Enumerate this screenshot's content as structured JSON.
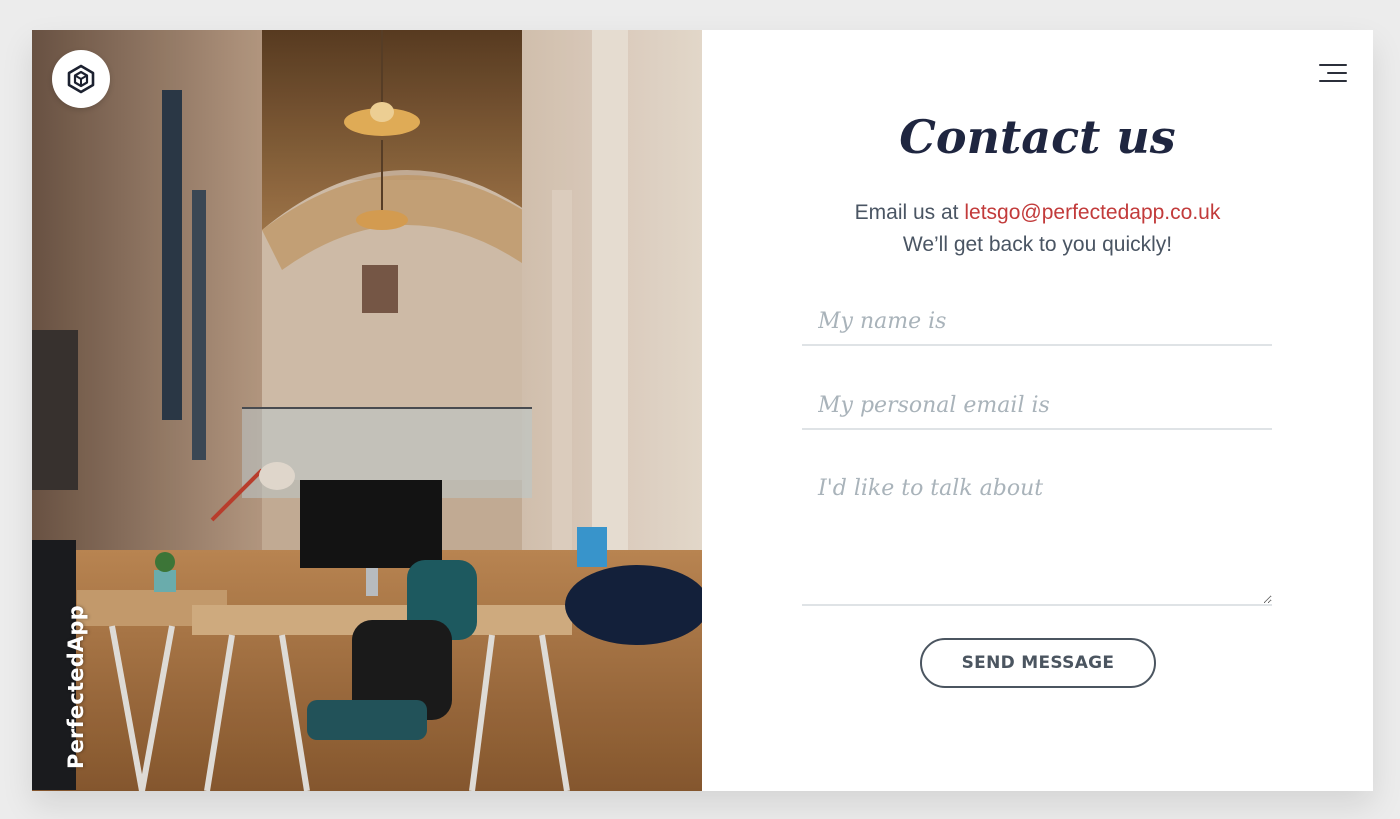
{
  "brand": {
    "name": "PerfectedApp",
    "logo_icon": "hexagon-cube-icon"
  },
  "header": {
    "menu_icon": "hamburger-menu-icon"
  },
  "contact": {
    "title": "Contact us",
    "intro_prefix": "Email us at",
    "email": "letsgo@perfectedapp.co.uk",
    "intro_line2": "We’ll get back to you quickly!"
  },
  "form": {
    "name_placeholder": "My name is",
    "email_placeholder": "My personal email is",
    "message_placeholder": "I'd like to talk about",
    "submit_label": "SEND MESSAGE"
  },
  "colors": {
    "accent": "#c23b3b",
    "title": "#1f2640",
    "text": "#4a5563",
    "placeholder": "#a9b3ba",
    "background": "#ececec"
  }
}
